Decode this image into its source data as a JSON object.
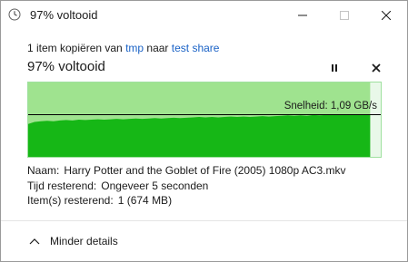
{
  "window": {
    "title": "97% voltooid",
    "icon": "clock-icon"
  },
  "summary": {
    "prefix": "1 item kopiëren van ",
    "source": "tmp",
    "middle": " naar ",
    "destination": "test share"
  },
  "progress": {
    "headline": "97% voltooid",
    "percent": 97,
    "speed_label": "Snelheid: 1,09 GB/s"
  },
  "graph": {
    "colors": {
      "background": "#e9f8e9",
      "done_area": "#9fe38f",
      "speed_fill": "#16b716",
      "line": "#000000"
    },
    "speed_samples": [
      0.85,
      0.9,
      0.92,
      0.93,
      0.92,
      0.94,
      0.95,
      0.94,
      0.96,
      0.95,
      0.96,
      0.97,
      0.96,
      0.97,
      0.98,
      0.97,
      0.98,
      0.99,
      0.98,
      0.99,
      1.0,
      0.99,
      1.0,
      1.01,
      1.0,
      1.01,
      1.02,
      1.03,
      1.02,
      1.03,
      1.02,
      1.03,
      1.04,
      1.03,
      1.04,
      1.03,
      1.04,
      1.05,
      1.04,
      1.05,
      1.06,
      1.07,
      1.06,
      1.07,
      1.06,
      1.08,
      1.07,
      1.08,
      1.09,
      1.08,
      1.09,
      1.09,
      1.08,
      1.09,
      1.09
    ],
    "current_speed": 1.09,
    "max_speed": 1.92
  },
  "details": {
    "name_key": "Naam:",
    "name_value": "Harry Potter and the Goblet of Fire (2005) 1080p AC3.mkv",
    "time_key": "Tijd resterend:",
    "time_value": "Ongeveer 5 seconden",
    "items_key": "Item(s) resterend:",
    "items_value": "1 (674 MB)"
  },
  "footer": {
    "less_details_label": "Minder details"
  }
}
